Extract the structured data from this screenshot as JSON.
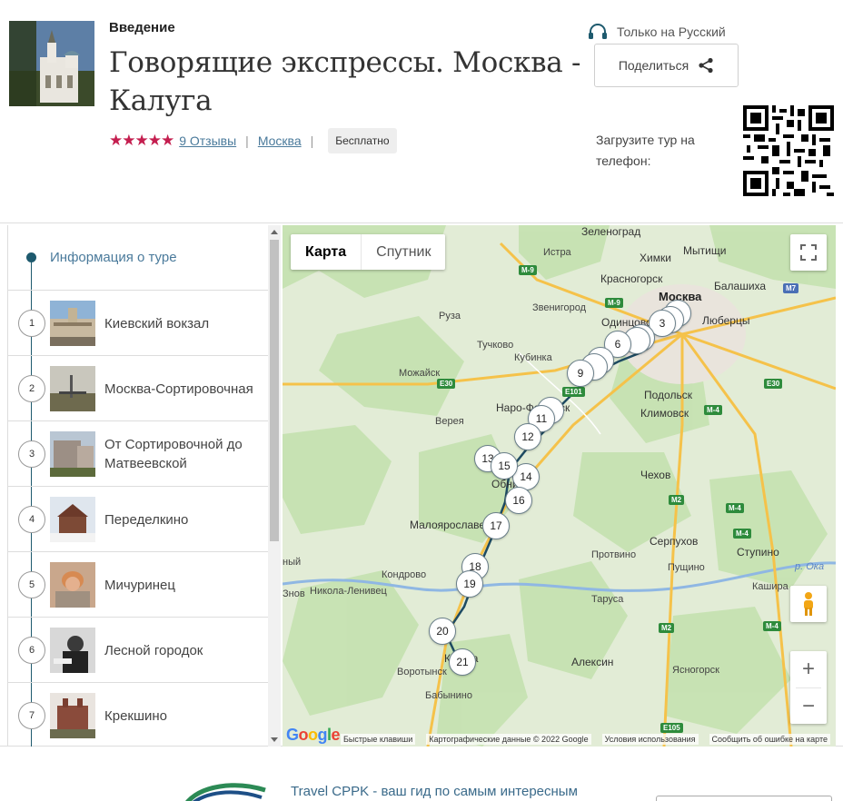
{
  "header": {
    "kicker": "Введение",
    "title": "Говорящие экспрессы. Москва - Калуга",
    "rating_stars": "★★★★★",
    "reviews_link": "9 Отзывы",
    "city_link": "Москва",
    "price_badge": "Бесплатно",
    "language": "Только на Русский",
    "share_label": "Поделиться",
    "download_text": "Загрузите тур на телефон:"
  },
  "sidebar": {
    "info_label": "Информация о туре",
    "stops": [
      {
        "num": "1",
        "label": "Киевский вокзал"
      },
      {
        "num": "2",
        "label": "Москва-Сортировочная"
      },
      {
        "num": "3",
        "label": "От Сортировочной до Матвеевской"
      },
      {
        "num": "4",
        "label": "Переделкино"
      },
      {
        "num": "5",
        "label": "Мичуринец"
      },
      {
        "num": "6",
        "label": "Лесной городок"
      },
      {
        "num": "7",
        "label": "Крекшино"
      }
    ]
  },
  "map": {
    "type_map": "Карта",
    "type_satellite": "Спутник",
    "zoom_in": "+",
    "zoom_out": "−",
    "attribution": {
      "shortcuts": "Быстрые клавиши",
      "data": "Картографические данные © 2022 Google",
      "terms": "Условия использования",
      "report": "Сообщить об ошибке на карте"
    },
    "google_logo": "Google",
    "cities": {
      "zelenograd": "Зеленоград",
      "istra": "Истра",
      "khimki": "Химки",
      "mytishchi": "Мытищи",
      "krasnogorsk": "Красногорск",
      "balashikha": "Балашиха",
      "moskva": "Москва",
      "zvenigorod": "Звенигород",
      "ruza": "Руза",
      "odintsovo": "Одинцово",
      "lyubertsy": "Люберцы",
      "tuchkovo": "Тучково",
      "kubinka": "Кубинка",
      "mozhaysk": "Можайск",
      "podolsk": "Подольск",
      "naro_fominsk": "Наро-Фоминск",
      "klimovsk": "Климовск",
      "vereya": "Верея",
      "obninsk": "Обнинск",
      "chekhov": "Чехов",
      "maloyaroslavets": "Малоярославец",
      "serpukhov": "Серпухов",
      "stupino": "Ступино",
      "protvino": "Протвино",
      "pushchino": "Пущино",
      "kondrovo": "Кондрово",
      "nikola_lenivets": "Никола-Ленивец",
      "kashira": "Кашира",
      "tarusa": "Таруса",
      "kaluga": "Калуга",
      "aleksin": "Алексин",
      "vorotynsk": "Воротынск",
      "yasnogorsk": "Ясногорск",
      "babynino": "Бабынино",
      "oka": "р. Ока",
      "znob": "Знов",
      "edge_y": "ный"
    },
    "road_labels": {
      "m9": "M-9",
      "m7": "M7",
      "e30": "E30",
      "m4": "M-4",
      "m2": "M2",
      "e101": "E101",
      "e105": "E105"
    },
    "markers": [
      "3",
      "6",
      "9",
      "11",
      "12",
      "13",
      "14",
      "15",
      "16",
      "17",
      "18",
      "19",
      "20",
      "21"
    ]
  },
  "footer": {
    "text": "Travel CPPK - ваш гид по самым интересным"
  }
}
